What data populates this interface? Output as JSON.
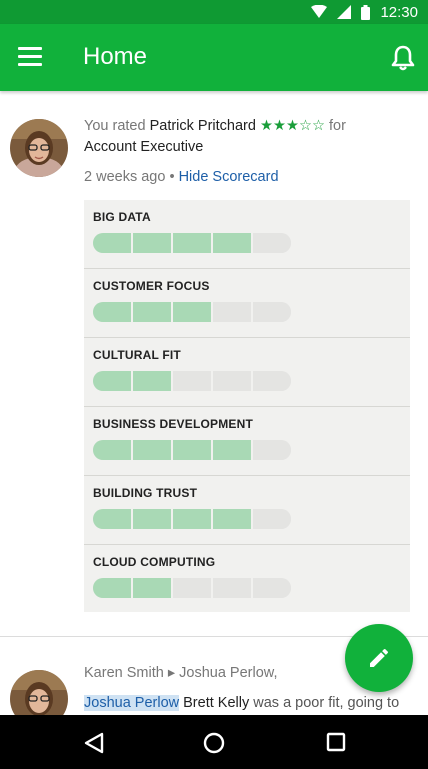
{
  "status_bar": {
    "time": "12:30"
  },
  "app_bar": {
    "title": "Home"
  },
  "post1": {
    "prefix": "You rated ",
    "person": "Patrick Pritchard",
    "stars_filled": "★★★",
    "stars_empty": "☆☆",
    "rating": 3,
    "rating_max": 5,
    "for_text": " for",
    "role": "Account Executive",
    "time_ago": "2 weeks ago",
    "separator": " • ",
    "hide_label": "Hide",
    "scorecard_label": "Scorecard",
    "skills": [
      {
        "name": "BIG DATA",
        "level": 4
      },
      {
        "name": "CUSTOMER FOCUS",
        "level": 3
      },
      {
        "name": "CULTURAL FIT",
        "level": 2
      },
      {
        "name": "BUSINESS DEVELOPMENT",
        "level": 4
      },
      {
        "name": "BUILDING TRUST",
        "level": 4
      },
      {
        "name": "CLOUD COMPUTING",
        "level": 2
      }
    ],
    "skill_max": 5
  },
  "post2": {
    "from": "Karen Smith",
    "arrow": " ▸ ",
    "to": "Joshua Perlow,",
    "mention": "Joshua Perlow",
    "subject": "Brett Kelly",
    "text": " was a poor fit, going to"
  },
  "colors": {
    "status_bar": "#0f9a33",
    "app_bar": "#11b13b",
    "star": "#1a9e3a",
    "bar_filled": "#a9d9b5",
    "link": "#1e5fa8"
  },
  "icons": {
    "menu": "hamburger-icon",
    "notifications": "bell-icon",
    "fab": "pencil-icon",
    "nav_back": "triangle-back-icon",
    "nav_home": "circle-home-icon",
    "nav_recents": "square-recents-icon"
  }
}
